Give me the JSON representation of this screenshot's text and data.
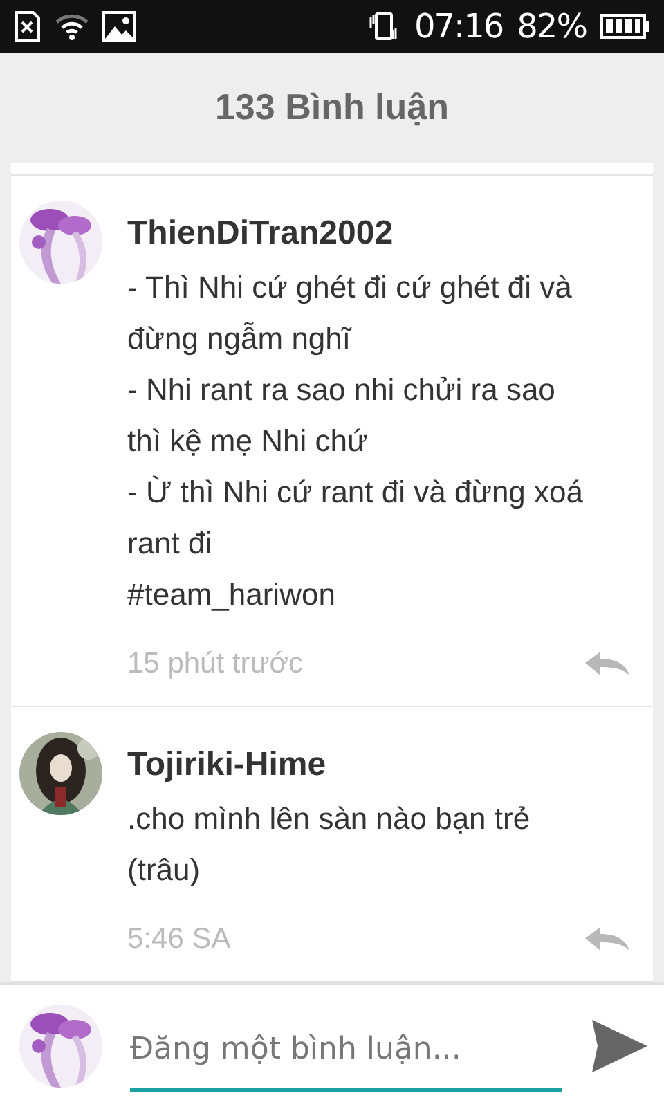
{
  "status_bar": {
    "time": "07:16",
    "battery_percent": "82%"
  },
  "header": {
    "title": "133 Bình luận"
  },
  "comments": [
    {
      "author": "ThienDiTran2002",
      "avatar": {
        "kind": "picture"
      },
      "lines": [
        "- Thì Nhi cứ ghét đi cứ ghét đi và đừng ngẫm nghĩ",
        "- Nhi rant ra sao nhi chửi ra sao thì kệ mẹ Nhi chứ",
        "- Ừ thì Nhi cứ rant đi và đừng xoá rant đi",
        "#team_hariwon"
      ],
      "time": "15 phút trước"
    },
    {
      "author": "Tojiriki-Hime",
      "avatar": {
        "kind": "picture"
      },
      "lines": [
        ".cho mình lên sàn nào bạn trẻ (trâu)"
      ],
      "time": "5:46 SA"
    }
  ],
  "composer": {
    "placeholder": "Đăng một bình luận..."
  }
}
